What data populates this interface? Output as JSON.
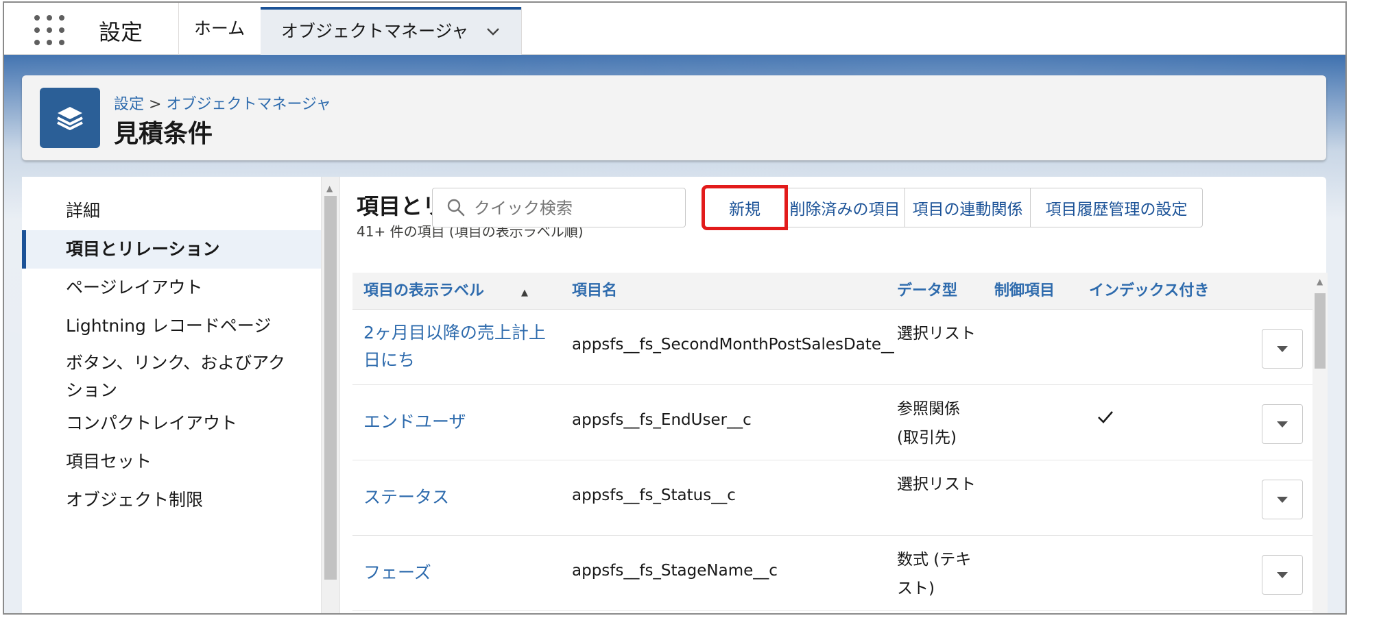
{
  "topbar": {
    "app_name": "設定",
    "tabs": [
      {
        "label": "ホーム"
      },
      {
        "label": "オブジェクトマネージャ"
      }
    ]
  },
  "header": {
    "breadcrumb_root": "設定",
    "breadcrumb_sep": ">",
    "breadcrumb_current": "オブジェクトマネージャ",
    "title": "見積条件"
  },
  "sidebar": {
    "items": [
      {
        "label": "詳細",
        "active": false
      },
      {
        "label": "項目とリレーション",
        "active": true
      },
      {
        "label": "ページレイアウト",
        "active": false
      },
      {
        "label": "Lightning レコードページ",
        "active": false
      },
      {
        "label": "ボタン、リンク、およびアクション",
        "active": false
      },
      {
        "label": "コンパクトレイアウト",
        "active": false
      },
      {
        "label": "項目セット",
        "active": false
      },
      {
        "label": "オブジェクト制限",
        "active": false
      }
    ]
  },
  "main": {
    "section_title": "項目とリ",
    "section_subtitle": "41+ 件の項目 (項目の表示ラベル順)",
    "search": {
      "placeholder": "クイック検索"
    },
    "buttons": {
      "new": "新規",
      "deleted_fields": "削除済みの項目",
      "dependencies": "項目の連動関係",
      "history_tracking": "項目履歴管理の設定"
    },
    "columns": {
      "label": "項目の表示ラベル",
      "api_name": "項目名",
      "data_type": "データ型",
      "controlling": "制御項目",
      "indexed": "インデックス付き"
    },
    "rows": [
      {
        "label": "2ヶ月目以降の売上計上日にち",
        "api_name": "appsfs__fs_SecondMonthPostSalesDate__c",
        "data_type": "選択リスト",
        "indexed": false
      },
      {
        "label": "エンドユーザ",
        "api_name": "appsfs__fs_EndUser__c",
        "data_type": "参照関係 (取引先)",
        "indexed": true
      },
      {
        "label": "ステータス",
        "api_name": "appsfs__fs_Status__c",
        "data_type": "選択リスト",
        "indexed": false
      },
      {
        "label": "フェーズ",
        "api_name": "appsfs__fs_StageName__c",
        "data_type": "数式 (テキスト)",
        "indexed": false
      }
    ]
  },
  "colors": {
    "brand_blue": "#1b5297",
    "link_blue": "#2e6bad",
    "highlight_red": "#e21b1b"
  }
}
